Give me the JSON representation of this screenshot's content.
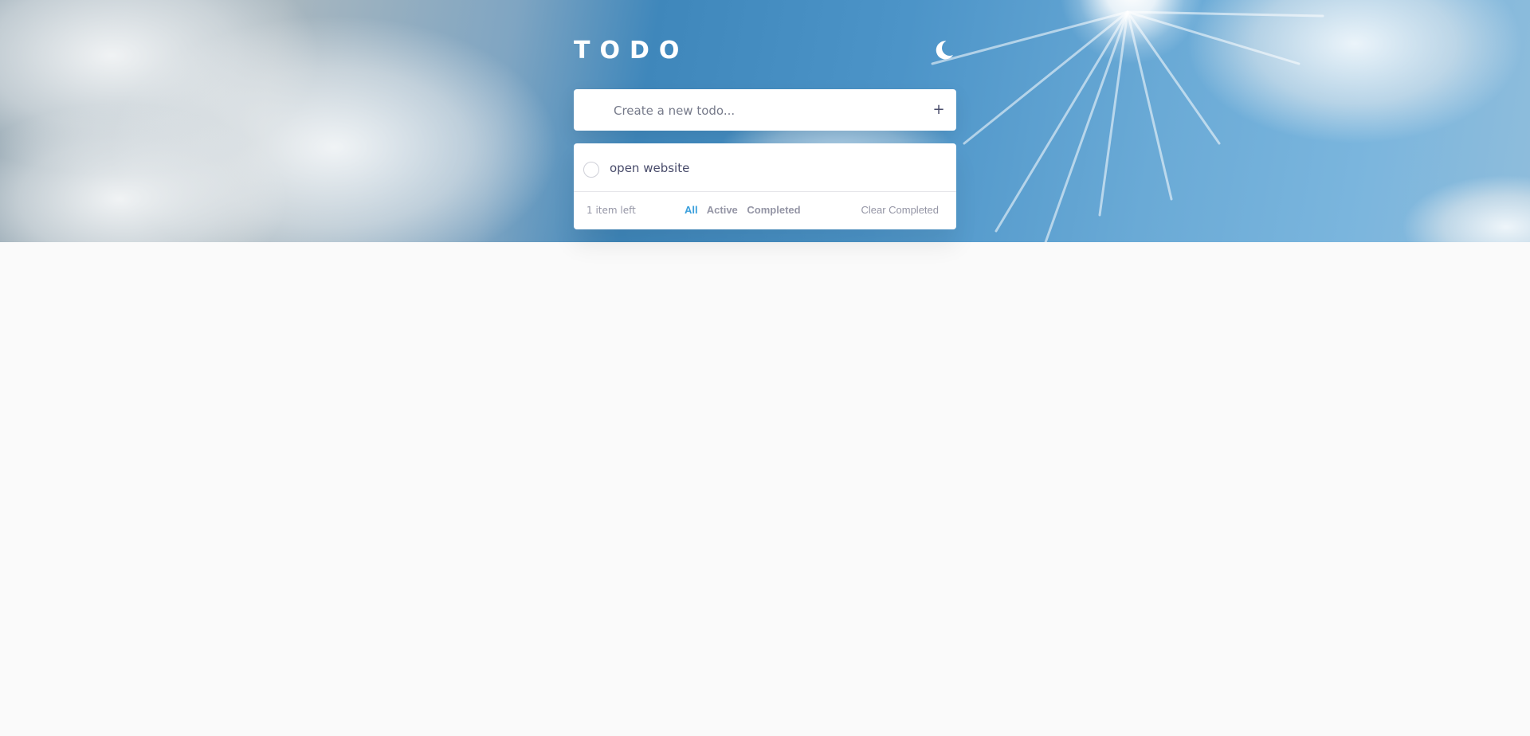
{
  "app": {
    "title": "TODO",
    "theme_icon": "moon-icon"
  },
  "create": {
    "placeholder": "Create a new todo...",
    "value": "",
    "add_label": "+"
  },
  "todos": [
    {
      "text": "open website",
      "completed": false
    }
  ],
  "footer": {
    "items_left": "1 item left",
    "filters": [
      {
        "label": "All",
        "active": true
      },
      {
        "label": "Active",
        "active": false
      },
      {
        "label": "Completed",
        "active": false
      }
    ],
    "clear_label": "Clear Completed"
  },
  "colors": {
    "accent": "#3a9fdc",
    "text": "#494c6b",
    "muted": "#9495a5",
    "page_background": "#fafafa",
    "card_background": "#ffffff"
  }
}
